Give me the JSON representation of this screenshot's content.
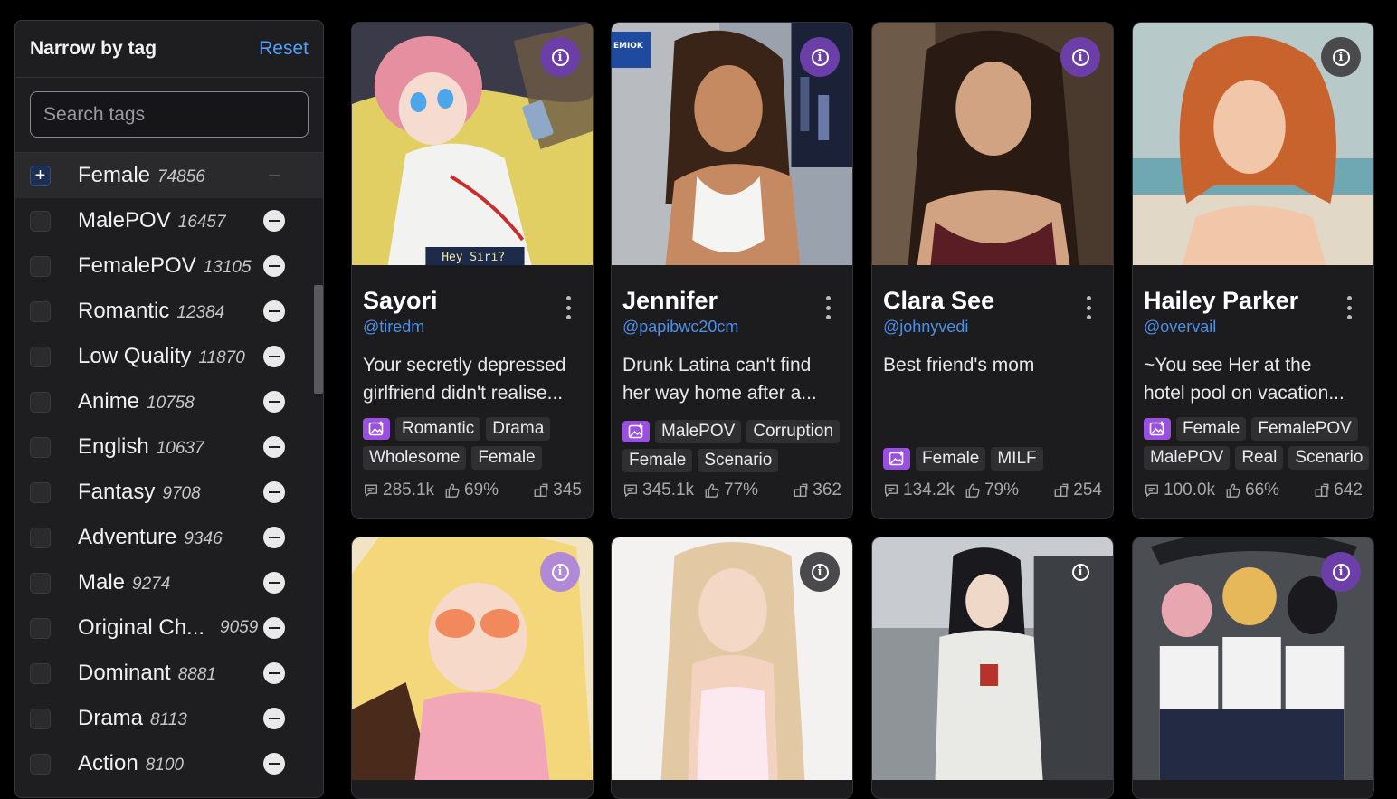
{
  "sidebar": {
    "title": "Narrow by tag",
    "reset_label": "Reset",
    "search_placeholder": "Search tags",
    "tags": [
      {
        "name": "Female",
        "count": "74856"
      },
      {
        "name": "MalePOV",
        "count": "16457"
      },
      {
        "name": "FemalePOV",
        "count": "13105"
      },
      {
        "name": "Romantic",
        "count": "12384"
      },
      {
        "name": "Low Quality",
        "count": "11870"
      },
      {
        "name": "Anime",
        "count": "10758"
      },
      {
        "name": "English",
        "count": "10637"
      },
      {
        "name": "Fantasy",
        "count": "9708"
      },
      {
        "name": "Adventure",
        "count": "9346"
      },
      {
        "name": "Male",
        "count": "9274"
      },
      {
        "name": "Original Ch...",
        "count": "9059"
      },
      {
        "name": "Dominant",
        "count": "8881"
      },
      {
        "name": "Drama",
        "count": "8113"
      },
      {
        "name": "Action",
        "count": "8100"
      }
    ]
  },
  "cards": [
    {
      "name": "Sayori",
      "handle": "@tiredm",
      "desc_line1": "Your secretly depressed",
      "desc_line2": "girlfriend didn't realise...",
      "tags_line1": [
        "Romantic",
        "Drama"
      ],
      "tags_line2": [
        "Wholesome",
        "Female"
      ],
      "messages": "285.1k",
      "likes": "69%",
      "chats": "345",
      "image_caption": "Hey Siri?"
    },
    {
      "name": "Jennifer",
      "handle": "@papibwc20cm",
      "desc_line1": "Drunk Latina can't find",
      "desc_line2": "her way home after a...",
      "tags_line1": [
        "MalePOV",
        "Corruption"
      ],
      "tags_line2": [
        "Female",
        "Scenario"
      ],
      "messages": "345.1k",
      "likes": "77%",
      "chats": "362",
      "image_caption": "EMIOK"
    },
    {
      "name": "Clara See",
      "handle": "@johnyvedi",
      "desc_line1": "Best friend's mom",
      "desc_line2": "",
      "tags_line1": [
        "Female",
        "MILF"
      ],
      "tags_line2": [],
      "messages": "134.2k",
      "likes": "79%",
      "chats": "254"
    },
    {
      "name": "Hailey Parker",
      "handle": "@overvail",
      "desc_line1": "~You see Her at the",
      "desc_line2": "hotel pool on vacation...",
      "tags_line1": [
        "Female",
        "FemalePOV"
      ],
      "tags_line2": [
        "MalePOV",
        "Real",
        "Scenario"
      ],
      "messages": "100.0k",
      "likes": "66%",
      "chats": "642"
    }
  ],
  "icons": {
    "info": "info-icon",
    "menu": "more-vertical-icon",
    "image_tag": "image-generation-icon",
    "messages": "message-icon",
    "likes": "thumbs-up-icon",
    "chats": "chat-count-icon"
  },
  "colors": {
    "accent_blue": "#4ea1ff",
    "info_purple": "#6c3fa8",
    "image_chip": "#9a4fe0"
  }
}
